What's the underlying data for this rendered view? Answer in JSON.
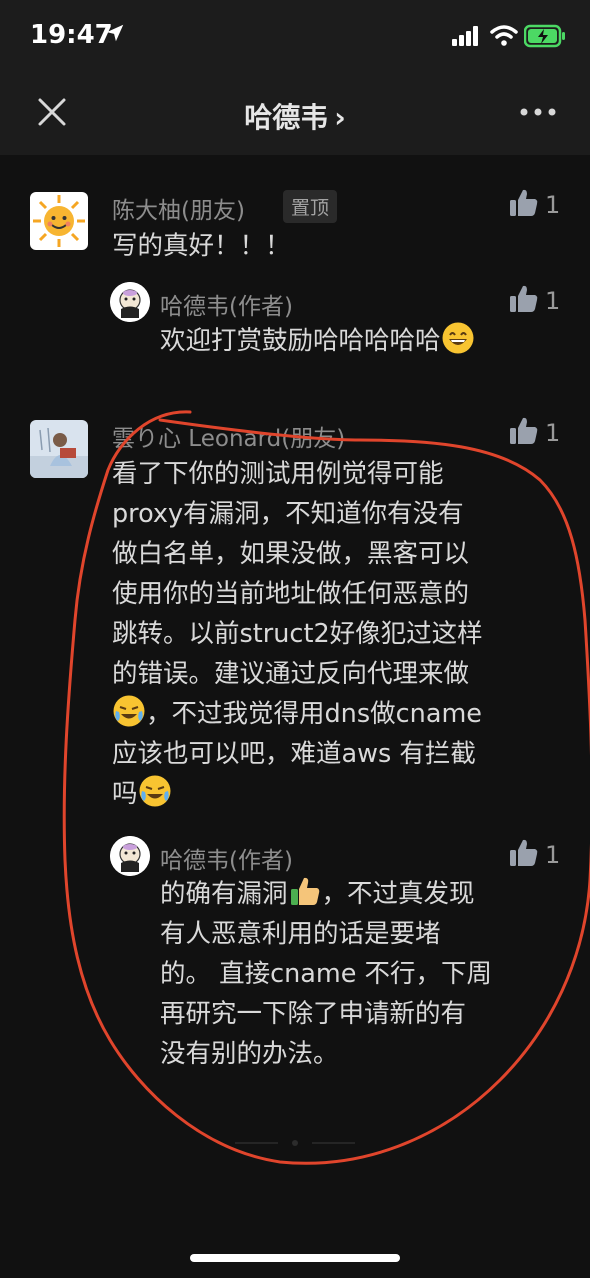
{
  "status_bar": {
    "time": "19:47",
    "icons": [
      "location-arrow-icon",
      "cellular-signal-icon",
      "wifi-icon",
      "battery-charging-icon"
    ]
  },
  "nav": {
    "title": "哈德韦",
    "chevron": "›",
    "icons": [
      "close-icon",
      "more-icon"
    ]
  },
  "comments": [
    {
      "author": "陈大柚(朋友)",
      "badge": "置顶",
      "likes": "1",
      "text": "写的真好！！！",
      "replies": [
        {
          "author": "哈德韦(作者)",
          "likes": "1",
          "text": "欢迎打赏鼓励哈哈哈哈哈",
          "emoji": "grinning-face-icon"
        }
      ]
    },
    {
      "author": "雲り心 Leonard(朋友)",
      "likes": "1",
      "text_lines": [
        "看了下你的测试用例觉得可能",
        "proxy有漏洞，不知道你有没有",
        "做白名单，如果没做，黑客可以",
        "使用你的当前地址做任何恶意的",
        "跳转。以前struct2好像犯过这样",
        "的错误。建议通过反向代理来做",
        "，不过我觉得用dns做cname",
        "应该也可以吧，难道aws 有拦截",
        "吗"
      ],
      "emoji": "crying-laughing-face-icon",
      "replies": [
        {
          "author": "哈德韦(作者)",
          "likes": "1",
          "text_lines": [
            "的确有漏洞",
            "，不过真发现",
            "有人恶意利用的话是要堵",
            "的。 直接cname 不行，下周",
            "再研究一下除了申请新的有",
            "没有别的办法。"
          ],
          "emoji": "thumbs-up-emoji-icon"
        }
      ]
    }
  ],
  "colors": {
    "background": "#111111",
    "header": "#1c1c1c",
    "annotation": "#e0452c",
    "battery": "#4cd964"
  }
}
